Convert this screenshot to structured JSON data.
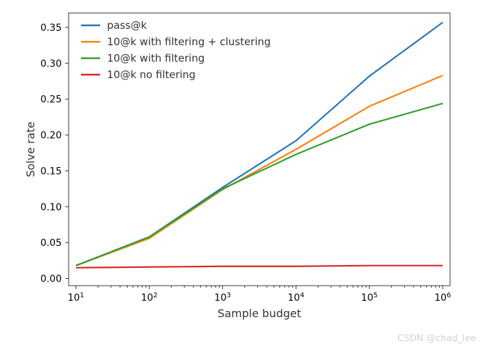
{
  "chart_data": {
    "type": "line",
    "xlabel": "Sample budget",
    "ylabel": "Solve rate",
    "x_scale": "log10",
    "x_ticks_exp": [
      1,
      2,
      3,
      4,
      5,
      6
    ],
    "x_tick_labels": [
      "10¹",
      "10²",
      "10³",
      "10⁴",
      "10⁵",
      "10⁶"
    ],
    "y_ticks": [
      0.0,
      0.05,
      0.1,
      0.15,
      0.2,
      0.25,
      0.3,
      0.35
    ],
    "y_tick_labels": [
      "0.00",
      "0.05",
      "0.10",
      "0.15",
      "0.20",
      "0.25",
      "0.30",
      "0.35"
    ],
    "xlim_exp": [
      0.9,
      6.1
    ],
    "ylim": [
      -0.01,
      0.37
    ],
    "x_exp": [
      1,
      2,
      3,
      4,
      5,
      6
    ],
    "series": [
      {
        "name": "pass@k",
        "color": "#1f77b4",
        "values": [
          0.018,
          0.058,
          0.127,
          0.192,
          0.282,
          0.357
        ]
      },
      {
        "name": "10@k with filtering + clustering",
        "color": "#ff7f0e",
        "values": [
          0.018,
          0.056,
          0.124,
          0.18,
          0.24,
          0.283
        ]
      },
      {
        "name": "10@k with filtering",
        "color": "#2ca02c",
        "values": [
          0.018,
          0.058,
          0.125,
          0.173,
          0.215,
          0.244
        ]
      },
      {
        "name": "10@k no filtering",
        "color": "#d62728",
        "values": [
          0.015,
          0.016,
          0.017,
          0.017,
          0.018,
          0.018
        ]
      }
    ],
    "legend_loc": "upper-left"
  },
  "watermark": "CSDN @chad_lee"
}
